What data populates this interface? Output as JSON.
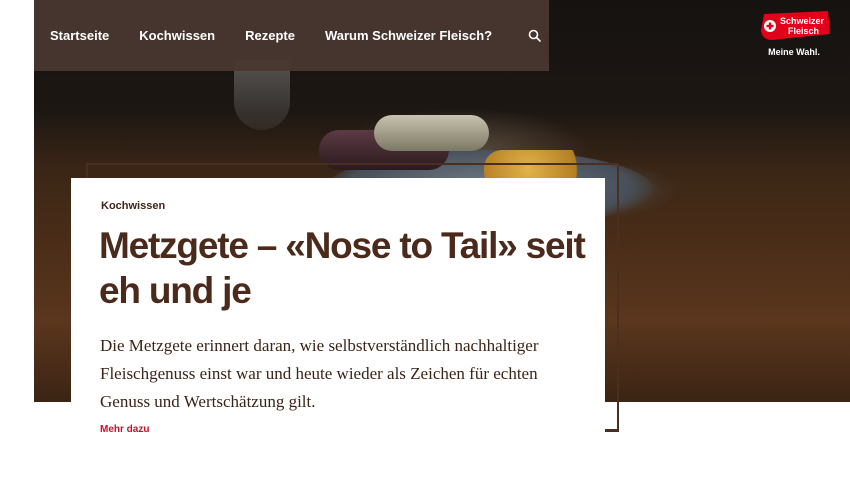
{
  "nav": {
    "items": [
      "Startseite",
      "Kochwissen",
      "Rezepte",
      "Warum Schweizer Fleisch?"
    ],
    "search_icon": "search-icon"
  },
  "logo": {
    "brand_line1": "Schweizer",
    "brand_line2": "Fleisch",
    "tagline": "Meine Wahl.",
    "color": "#e2001a"
  },
  "hero": {
    "image": "metzgete-plate-photo"
  },
  "article": {
    "category": "Kochwissen",
    "title": "Metzgete – «Nose to Tail» seit eh und je",
    "teaser": "Die Metzgete erinnert daran, wie selbstverständlich nachhaltiger Fleischgenuss einst war und heute wieder als Zeichen für echten Genuss und Wertschätzung gilt.",
    "more_label": "Mehr dazu"
  },
  "colors": {
    "nav_bg": "#48372f",
    "title": "#4a2a1b",
    "accent": "#c8102e"
  }
}
